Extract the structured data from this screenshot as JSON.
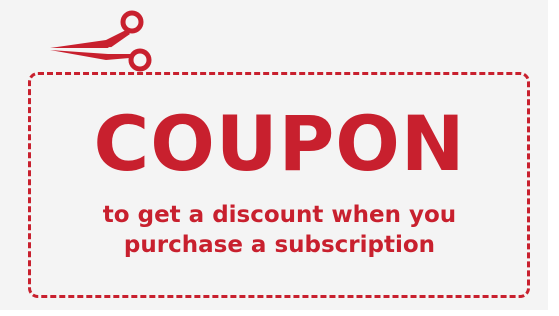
{
  "coupon": {
    "title": "COUPON",
    "subtitle_line1": "to get a discount when you",
    "subtitle_line2": "purchase a subscription"
  },
  "icons": {
    "scissors": "scissors-icon"
  },
  "colors": {
    "accent": "#c8202e",
    "background": "#f4f4f4"
  }
}
